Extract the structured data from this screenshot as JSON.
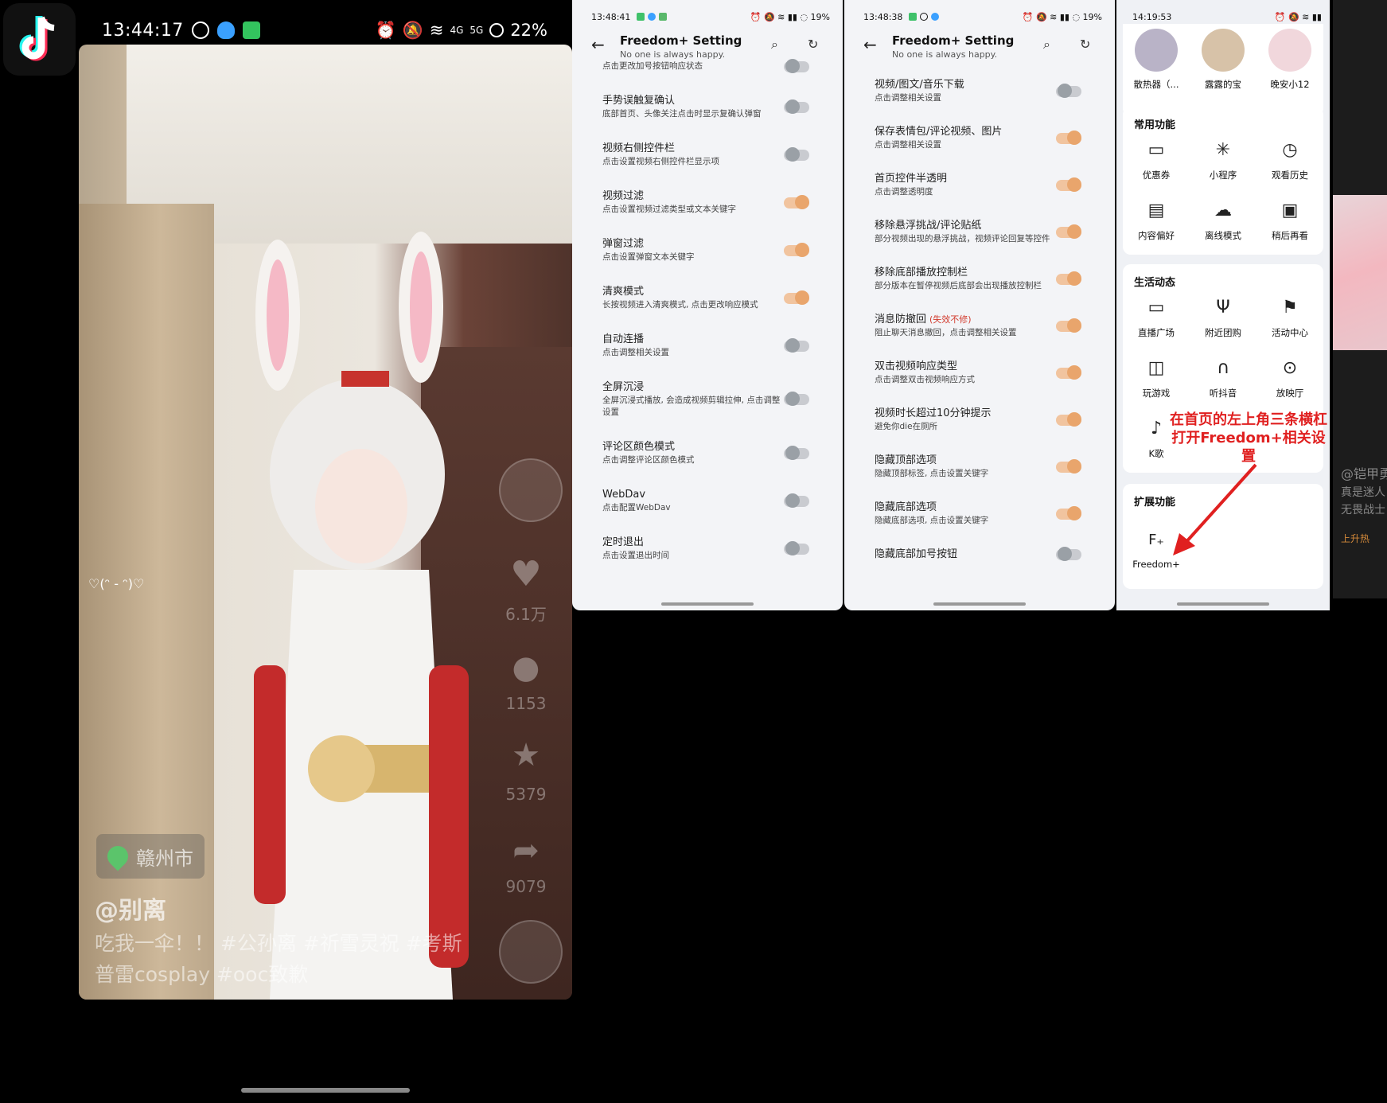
{
  "panel1": {
    "status": {
      "time": "13:44:17",
      "network": "4G",
      "network2": "5G",
      "battery": "22%"
    },
    "video": {
      "location": "赣州市",
      "author": "@别离",
      "caption": "吃我一伞！！ #公孙离 #祈雪灵祝 #考斯普雷cosplay #ooc致歉",
      "emote": "♡(ᵔ - ᵔ)♡",
      "likes": "6.1万",
      "comments": "1153",
      "favorites": "5379",
      "shares": "9079"
    }
  },
  "panel2": {
    "status": {
      "time": "13:48:41",
      "battery": "19%"
    },
    "header": {
      "title": "Freedom+ Setting",
      "subtitle": "No one is always happy."
    },
    "rows": [
      {
        "title": "",
        "desc": "点击更改加号按钮响应状态",
        "on": false
      },
      {
        "title": "手势误触复确认",
        "desc": "底部首页、头像关注点击时显示复确认弹窗",
        "on": false
      },
      {
        "title": "视频右侧控件栏",
        "desc": "点击设置视频右侧控件栏显示项",
        "on": false
      },
      {
        "title": "视频过滤",
        "desc": "点击设置视频过滤类型或文本关键字",
        "on": true
      },
      {
        "title": "弹窗过滤",
        "desc": "点击设置弹窗文本关键字",
        "on": true
      },
      {
        "title": "清爽模式",
        "desc": "长按视频进入清爽模式, 点击更改响应模式",
        "on": true
      },
      {
        "title": "自动连播",
        "desc": "点击调整相关设置",
        "on": false
      },
      {
        "title": "全屏沉浸",
        "desc": "全屏沉浸式播放, 会造成视频剪辑拉伸, 点击调整设置",
        "on": false
      },
      {
        "title": "评论区颜色模式",
        "desc": "点击调整评论区颜色模式",
        "on": false
      },
      {
        "title": "WebDav",
        "desc": "点击配置WebDav",
        "on": false
      },
      {
        "title": "定时退出",
        "desc": "点击设置退出时间",
        "on": false
      }
    ]
  },
  "panel3": {
    "status": {
      "time": "13:48:38",
      "battery": "19%"
    },
    "header": {
      "title": "Freedom+ Setting",
      "subtitle": "No one is always happy."
    },
    "rows": [
      {
        "title": "视频/图文/音乐下载",
        "desc": "点击调整相关设置",
        "on": false
      },
      {
        "title": "保存表情包/评论视频、图片",
        "desc": "点击调整相关设置",
        "on": true
      },
      {
        "title": "首页控件半透明",
        "desc": "点击调整透明度",
        "on": true
      },
      {
        "title": "移除悬浮挑战/评论贴纸",
        "desc": "部分视频出现的悬浮挑战，视频评论回复等控件",
        "on": true
      },
      {
        "title": "移除底部播放控制栏",
        "desc": "部分版本在暂停视频后底部会出现播放控制栏",
        "on": true
      },
      {
        "title": "消息防撤回",
        "fail": "(失效不修)",
        "desc": "阻止聊天消息撤回，点击调整相关设置",
        "on": true
      },
      {
        "title": "双击视频响应类型",
        "desc": "点击调整双击视频响应方式",
        "on": true
      },
      {
        "title": "视频时长超过10分钟提示",
        "desc": "避免你die在厕所",
        "on": true
      },
      {
        "title": "隐藏顶部选项",
        "desc": "隐藏顶部标签, 点击设置关键字",
        "on": true
      },
      {
        "title": "隐藏底部选项",
        "desc": "隐藏底部选项, 点击设置关键字",
        "on": true
      },
      {
        "title": "隐藏底部加号按钮",
        "desc": "",
        "on": false
      }
    ]
  },
  "panel4": {
    "status": {
      "time": "14:19:53"
    },
    "friends": [
      {
        "name": "散热器（...",
        "color": "#b9b3c7"
      },
      {
        "name": "露露的宝",
        "color": "#d7c2a8"
      },
      {
        "name": "晚安小12",
        "color": "#f1d7dc"
      }
    ],
    "common": {
      "title": "常用功能",
      "items": [
        {
          "label": "优惠券",
          "icon": "coupon-icon",
          "glyph": "▭"
        },
        {
          "label": "小程序",
          "icon": "mini-program-icon",
          "glyph": "✳"
        },
        {
          "label": "观看历史",
          "icon": "history-icon",
          "glyph": "◷"
        },
        {
          "label": "内容偏好",
          "icon": "preference-icon",
          "glyph": "▤"
        },
        {
          "label": "离线模式",
          "icon": "offline-icon",
          "glyph": "☁"
        },
        {
          "label": "稍后再看",
          "icon": "watch-later-icon",
          "glyph": "▣"
        }
      ]
    },
    "life": {
      "title": "生活动态",
      "items": [
        {
          "label": "直播广场",
          "icon": "live-icon",
          "glyph": "▭"
        },
        {
          "label": "附近团购",
          "icon": "groupbuy-icon",
          "glyph": "Ψ"
        },
        {
          "label": "活动中心",
          "icon": "flag-icon",
          "glyph": "⚑"
        },
        {
          "label": "玩游戏",
          "icon": "gamepad-icon",
          "glyph": "◫"
        },
        {
          "label": "听抖音",
          "icon": "headphones-icon",
          "glyph": "∩"
        },
        {
          "label": "放映厅",
          "icon": "cinema-icon",
          "glyph": "⊙"
        },
        {
          "label": "K歌",
          "icon": "mic-icon",
          "glyph": "♪"
        }
      ]
    },
    "extension": {
      "title": "扩展功能",
      "item": {
        "label": "Freedom+",
        "icon": "freedom-plus-icon",
        "glyph": "F₊"
      }
    },
    "annotation": "在首页的左上角三条横杠打开Freedom+相关设置",
    "edge": {
      "author": "@铠甲勇",
      "line1": "真是迷人",
      "line2": "无畏战士",
      "trend": "上升热"
    }
  },
  "colors": {
    "toggle_on": "#e9a56c",
    "toggle_off": "#9aa0a6",
    "annotation": "#e02020",
    "fail": "#d23b2e"
  }
}
